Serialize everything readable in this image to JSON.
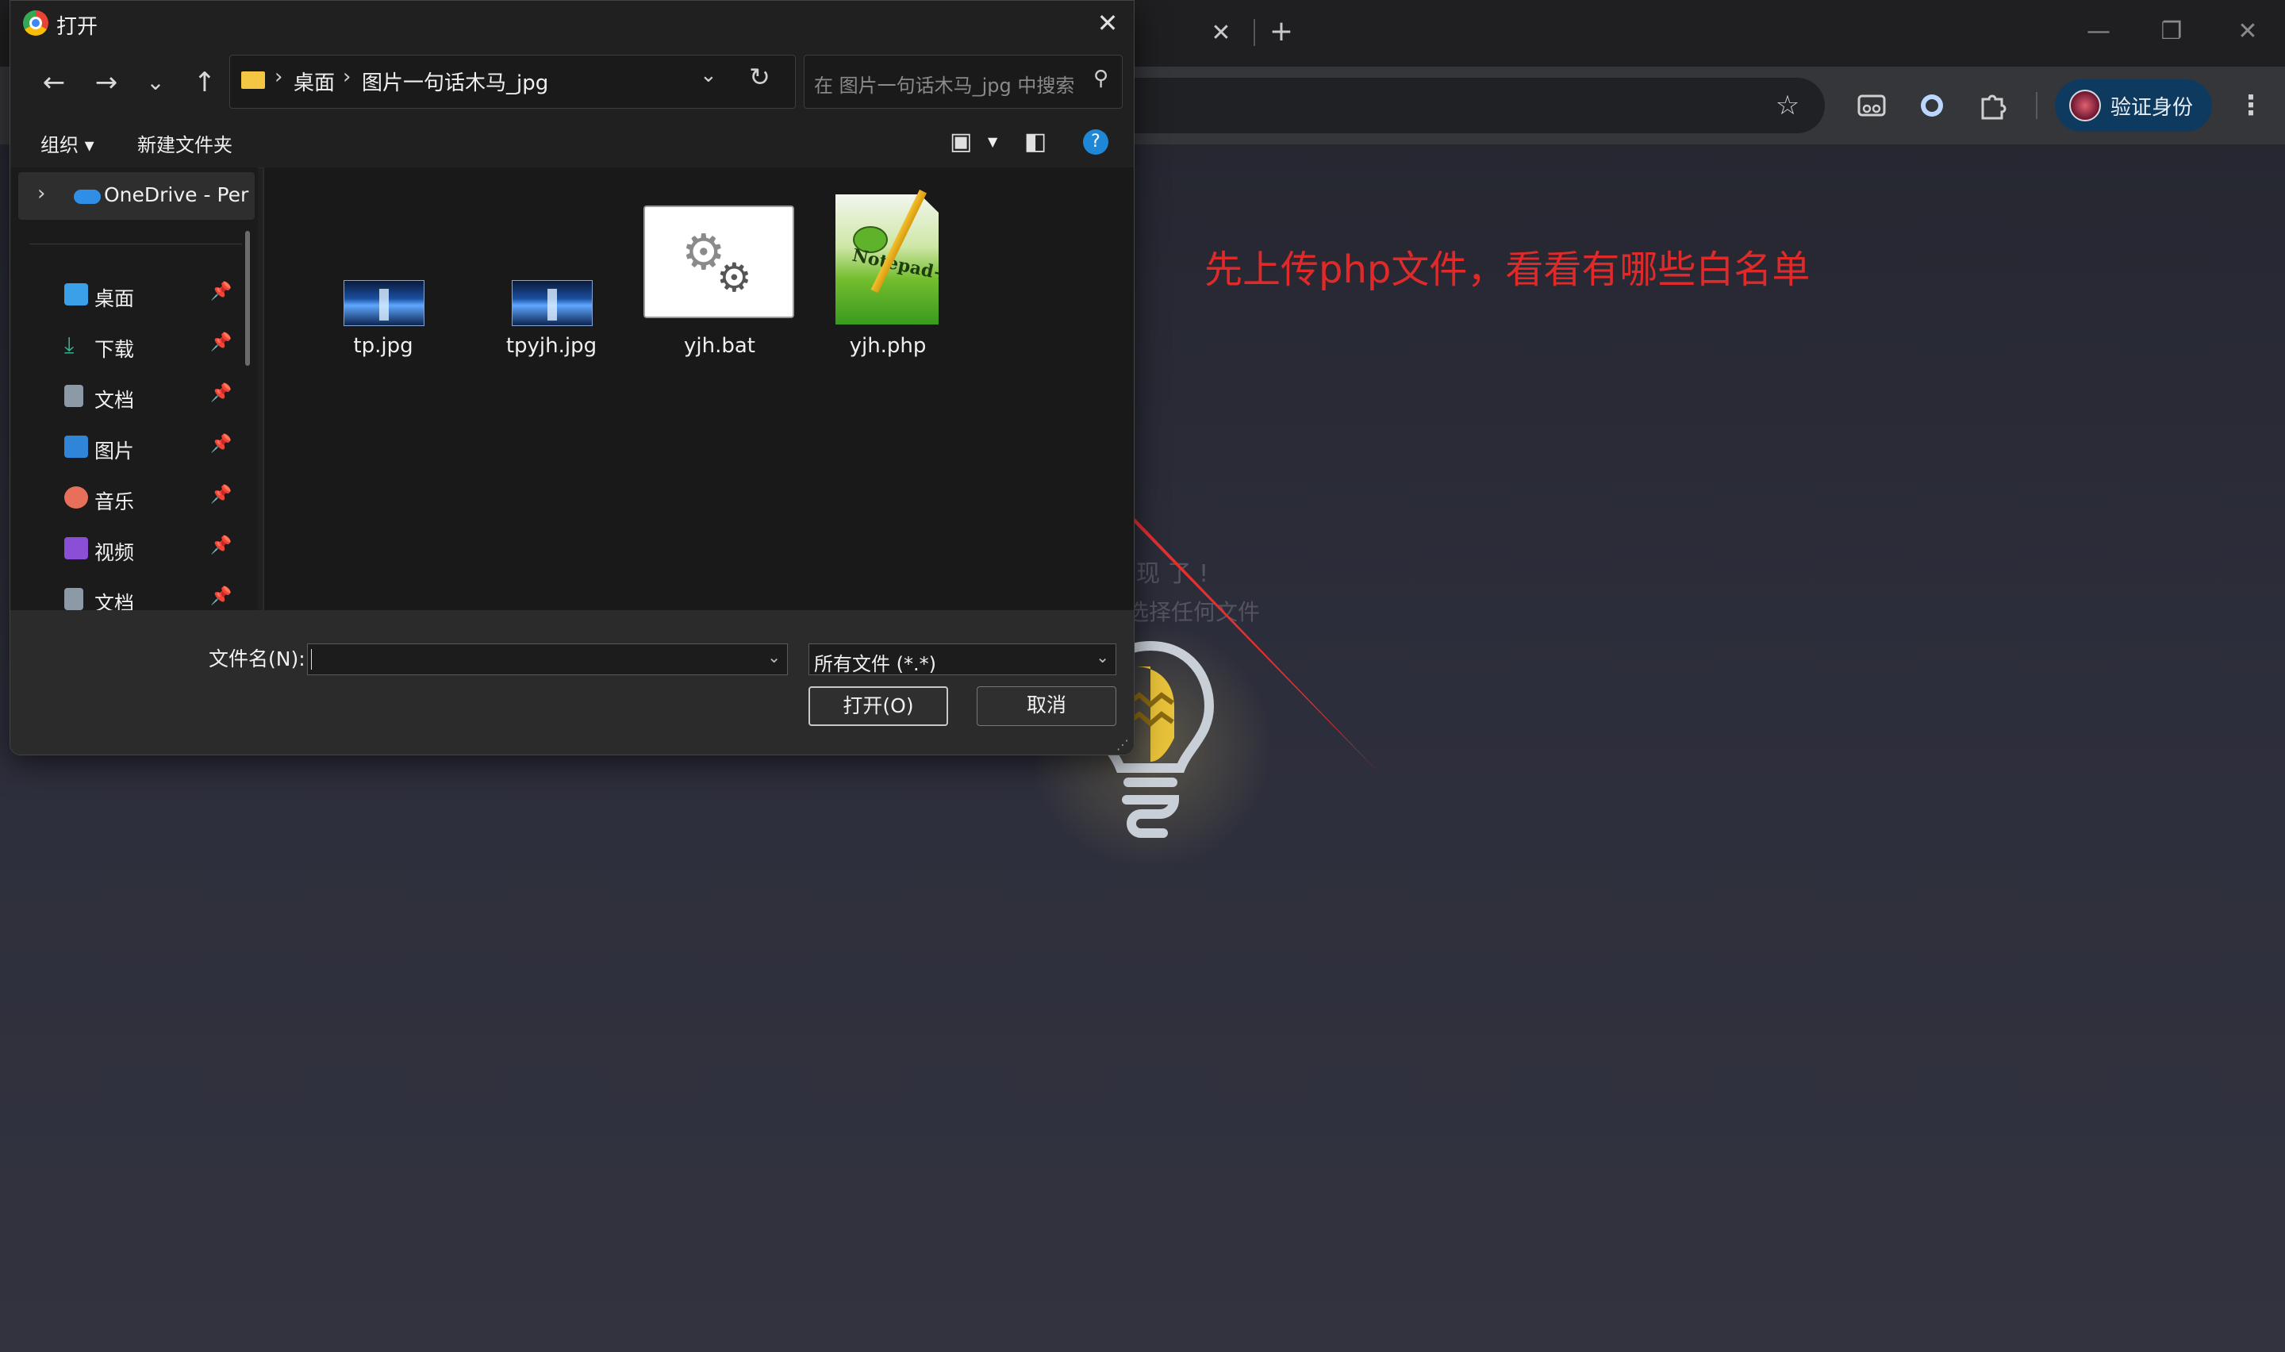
{
  "browser": {
    "tab_close": "✕",
    "new_tab": "+",
    "window_controls": [
      "—",
      "❐",
      "✕"
    ],
    "verify_label": "验证身份",
    "icons": [
      "star-icon",
      "reading-mode-icon",
      "extension-circle-icon",
      "extensions-puzzle-icon",
      "more-menu-icon"
    ]
  },
  "page": {
    "annotation": "先上传php文件，看看有哪些白名单",
    "faint_line1": "现 了 !",
    "faint_line2": "选择任何文件",
    "arrow_color": "#e02a2a"
  },
  "dialog": {
    "title": "打开",
    "close": "✕",
    "nav": {
      "back": "←",
      "forward": "→",
      "recent": "⌄",
      "up": "↑"
    },
    "address": {
      "crumbs": [
        "桌面",
        "图片一句话木马_jpg"
      ],
      "separator": "›"
    },
    "search_placeholder": "在 图片一句话木马_jpg 中搜索",
    "commands": {
      "organize": "组织",
      "new_folder": "新建文件夹"
    },
    "sidebar": {
      "onedrive": "OneDrive - Per",
      "items": [
        {
          "label": "桌面",
          "icon": "desktop-icon",
          "color": "#3aa0e8"
        },
        {
          "label": "下载",
          "icon": "download-icon",
          "color": "#3bb08f"
        },
        {
          "label": "文档",
          "icon": "documents-icon",
          "color": "#8c9aa8"
        },
        {
          "label": "图片",
          "icon": "pictures-icon",
          "color": "#2f86d8"
        },
        {
          "label": "音乐",
          "icon": "music-icon",
          "color": "#e8705a"
        },
        {
          "label": "视频",
          "icon": "videos-icon",
          "color": "#8a4fd6"
        },
        {
          "label": "文档",
          "icon": "documents-icon",
          "color": "#8c9aa8"
        }
      ]
    },
    "files": [
      {
        "name": "tp.jpg",
        "kind": "image"
      },
      {
        "name": "tpyjh.jpg",
        "kind": "image"
      },
      {
        "name": "yjh.bat",
        "kind": "batch"
      },
      {
        "name": "yjh.php",
        "kind": "notepad++"
      }
    ],
    "filename_label": "文件名(N):",
    "filename_value": "",
    "filetype_value": "所有文件 (*.*)",
    "open_button": "打开(O)",
    "cancel_button": "取消"
  }
}
